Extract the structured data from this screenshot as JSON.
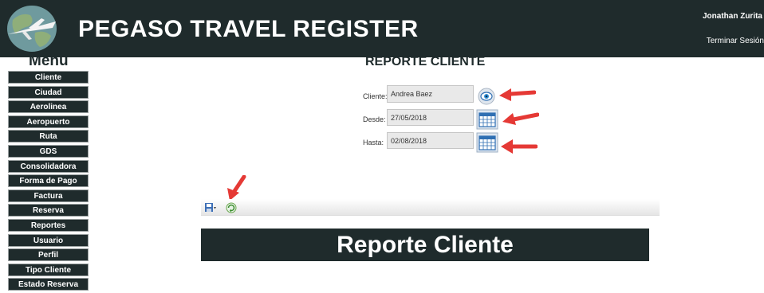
{
  "header": {
    "app_title": "PEGASO TRAVEL REGISTER",
    "user_name": "Jonathan Zurita",
    "logout_label": "Terminar Sesión",
    "icon": "globe-airplane-icon"
  },
  "sidebar": {
    "title": "Menú",
    "items": [
      {
        "label": "Cliente"
      },
      {
        "label": "Ciudad"
      },
      {
        "label": "Aerolinea"
      },
      {
        "label": "Aeropuerto"
      },
      {
        "label": "Ruta"
      },
      {
        "label": "GDS"
      },
      {
        "label": "Consolidadora"
      },
      {
        "label": "Forma de Pago"
      },
      {
        "label": "Factura"
      },
      {
        "label": "Reserva"
      },
      {
        "label": "Reportes"
      },
      {
        "label": "Usuario"
      },
      {
        "label": "Perfil"
      },
      {
        "label": "Tipo Cliente"
      },
      {
        "label": "Estado Reserva"
      }
    ]
  },
  "main": {
    "title": "REPORTE CLIENTE",
    "form": {
      "cliente": {
        "label": "Cliente:",
        "value": "Andrea Baez",
        "button_icon": "eye-icon"
      },
      "desde": {
        "label": "Desde:",
        "value": "27/05/2018",
        "button_icon": "calendar-icon"
      },
      "hasta": {
        "label": "Hasta:",
        "value": "02/08/2018",
        "button_icon": "calendar-icon"
      }
    },
    "toolbar": {
      "icons": [
        "save-icon",
        "refresh-icon"
      ]
    },
    "report": {
      "banner_title": "Reporte Cliente"
    }
  },
  "colors": {
    "header_bg": "#1f2b2c",
    "annotation_arrow": "#e53935"
  }
}
